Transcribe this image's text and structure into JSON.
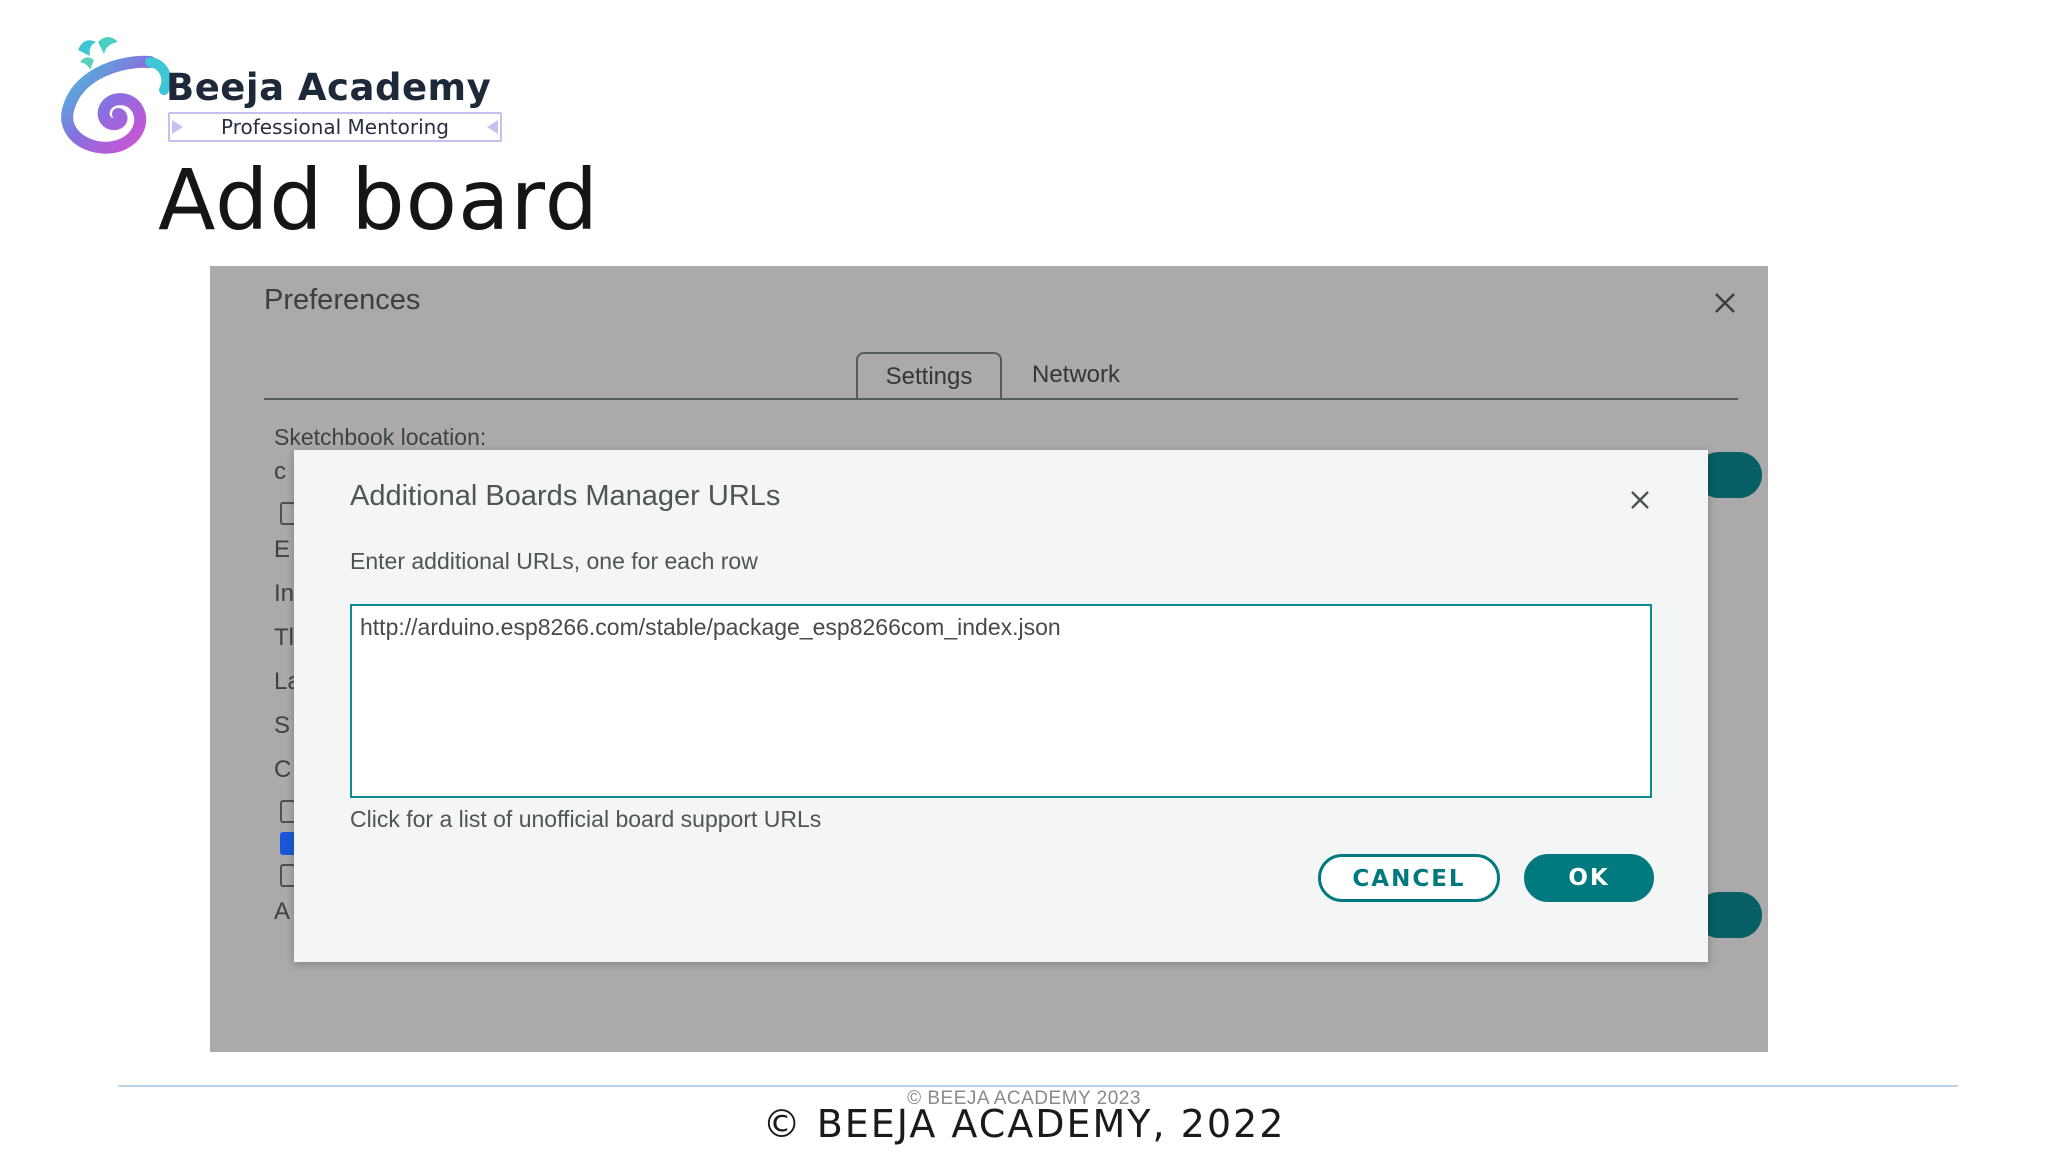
{
  "logo": {
    "name": "Beeja Academy",
    "tagline": "Professional Mentoring"
  },
  "slide": {
    "title": "Add board"
  },
  "preferences": {
    "title": "Preferences",
    "tabs": [
      {
        "label": "Settings",
        "active": true
      },
      {
        "label": "Network",
        "active": false
      }
    ],
    "sketchbook_label": "Sketchbook location:",
    "peek_letters": [
      "c",
      "E",
      "In",
      "Tl",
      "La",
      "S",
      "C",
      "A"
    ],
    "peek_checkboxes": [
      false,
      true,
      false
    ]
  },
  "dialog": {
    "title": "Additional Boards Manager URLs",
    "instruction": "Enter additional URLs, one for each row",
    "url_value": "http://arduino.esp8266.com/stable/package_esp8266com_index.json",
    "link_text": "Click for a list of unofficial board support URLs",
    "cancel_label": "CANCEL",
    "ok_label": "OK"
  },
  "footer": {
    "watermark": "© BEEJA ACADEMY 2023",
    "copyright": "© BEEJA ACADEMY, 2022"
  },
  "colors": {
    "accent": "#00797f",
    "overlay": "#a9aaa9",
    "dialog_bg": "#f4f5f5",
    "checkbox_checked": "#1c58d6"
  },
  "icons": {
    "dialog_close": "close-icon",
    "window_close": "close-icon"
  }
}
